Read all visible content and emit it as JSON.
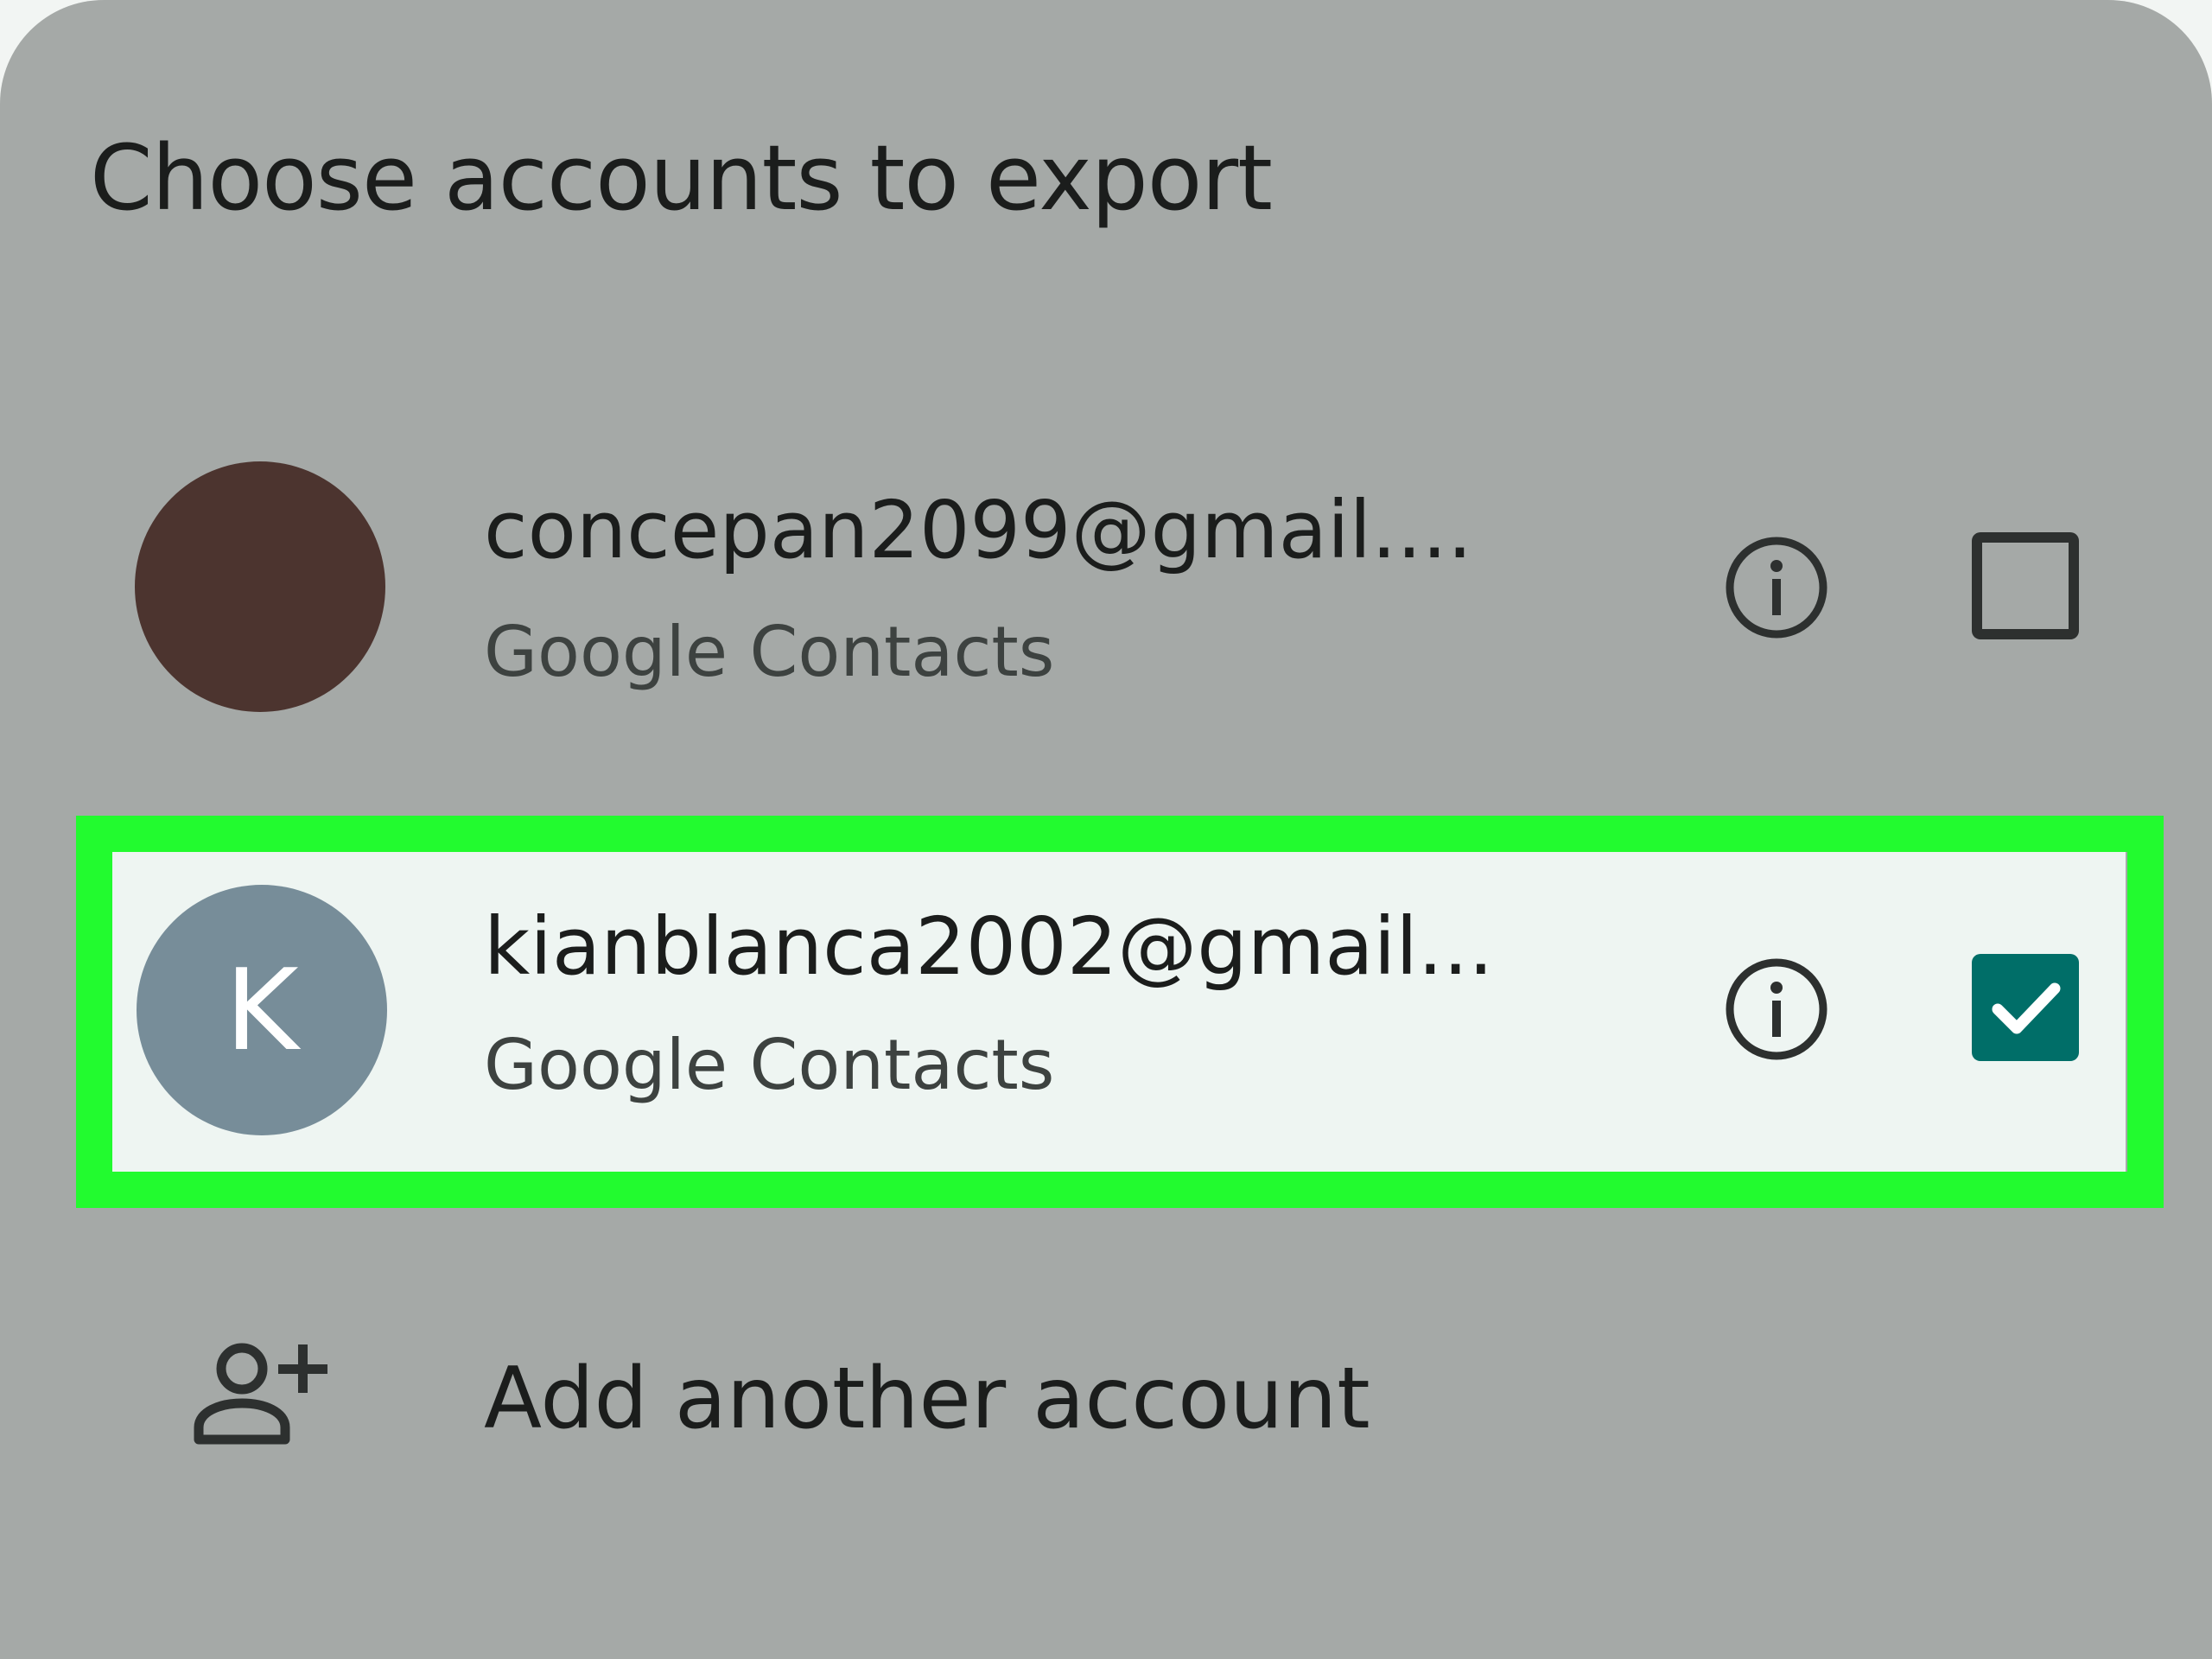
{
  "dialog": {
    "title": "Choose accounts to export"
  },
  "accounts": [
    {
      "email": "concepan2099@gmail....",
      "source": "Google Contacts",
      "avatar_color": "#4c342f",
      "avatar_initial": "",
      "checked": false,
      "info_icon": "info-icon"
    },
    {
      "email": "kianblanca2002@gmail...",
      "source": "Google Contacts",
      "avatar_color": "#778d99",
      "avatar_initial": "K",
      "checked": true,
      "info_icon": "info-icon",
      "highlighted": true
    }
  ],
  "add_account": {
    "label": "Add another account",
    "icon": "person-add-icon"
  },
  "colors": {
    "sheet_background": "#a5a9a7",
    "selected_row_background": "#eef5f2",
    "checkbox_checked": "#006e68",
    "highlight_frame": "#22fb2f"
  }
}
